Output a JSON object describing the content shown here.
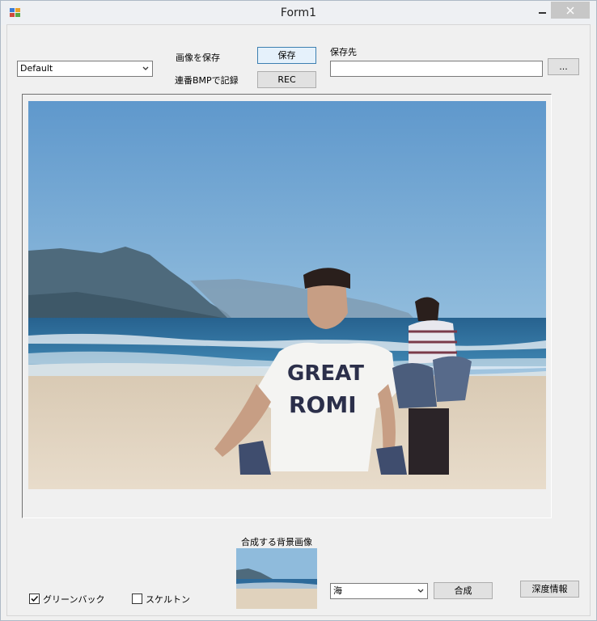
{
  "window": {
    "title": "Form1"
  },
  "controls": {
    "preset_combo": "Default",
    "save_image_label": "画像を保存",
    "save_button": "保存",
    "record_label": "連番BMPで記録",
    "rec_button": "REC",
    "destination_label": "保存先",
    "destination_value": "",
    "browse_button": "..."
  },
  "bottom": {
    "background_label": "合成する背景画像",
    "background_combo": "海",
    "compose_button": "合成",
    "depth_button": "深度情報",
    "greenback_label": "グリーンバック",
    "greenback_checked": true,
    "skeleton_label": "スケルトン",
    "skeleton_checked": false
  },
  "colors": {
    "sky_top": "#6a9fcf",
    "sky_bottom": "#9ec2de",
    "sea": "#2d6a9a",
    "sand": "#e3d6c3",
    "mountain": "#4f6a7d"
  }
}
